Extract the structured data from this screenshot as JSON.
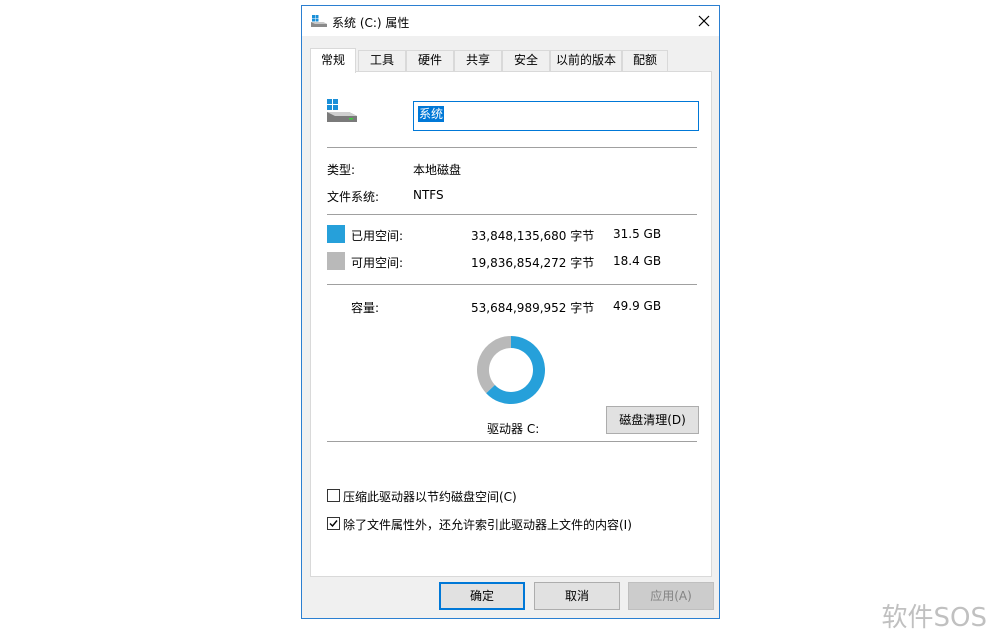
{
  "window": {
    "title": "系统 (C:) 属性",
    "close_icon": "close-icon",
    "title_icon": "drive-icon"
  },
  "tabs": [
    {
      "label": "常规",
      "active": true
    },
    {
      "label": "工具",
      "active": false
    },
    {
      "label": "硬件",
      "active": false
    },
    {
      "label": "共享",
      "active": false
    },
    {
      "label": "安全",
      "active": false
    },
    {
      "label": "以前的版本",
      "active": false
    },
    {
      "label": "配额",
      "active": false
    }
  ],
  "general": {
    "drive_name_value": "系统",
    "type_label": "类型:",
    "type_value": "本地磁盘",
    "fs_label": "文件系统:",
    "fs_value": "NTFS",
    "used": {
      "label": "已用空间:",
      "bytes": "33,848,135,680 字节",
      "size": "31.5 GB",
      "color": "#26a0da"
    },
    "free": {
      "label": "可用空间:",
      "bytes": "19,836,854,272 字节",
      "size": "18.4 GB",
      "color": "#b9b9b9"
    },
    "capacity": {
      "label": "容量:",
      "bytes": "53,684,989,952 字节",
      "size": "49.9 GB"
    },
    "drive_label": "驱动器 C:",
    "cleanup_button": "磁盘清理(D)",
    "compress_label": "压缩此驱动器以节约磁盘空间(C)",
    "compress_checked": false,
    "index_label": "除了文件属性外，还允许索引此驱动器上文件的内容(I)",
    "index_checked": true,
    "used_fraction": 0.6305
  },
  "footer": {
    "ok_label": "确定",
    "cancel_label": "取消",
    "apply_label": "应用(A)"
  },
  "watermark": "软件SOS"
}
